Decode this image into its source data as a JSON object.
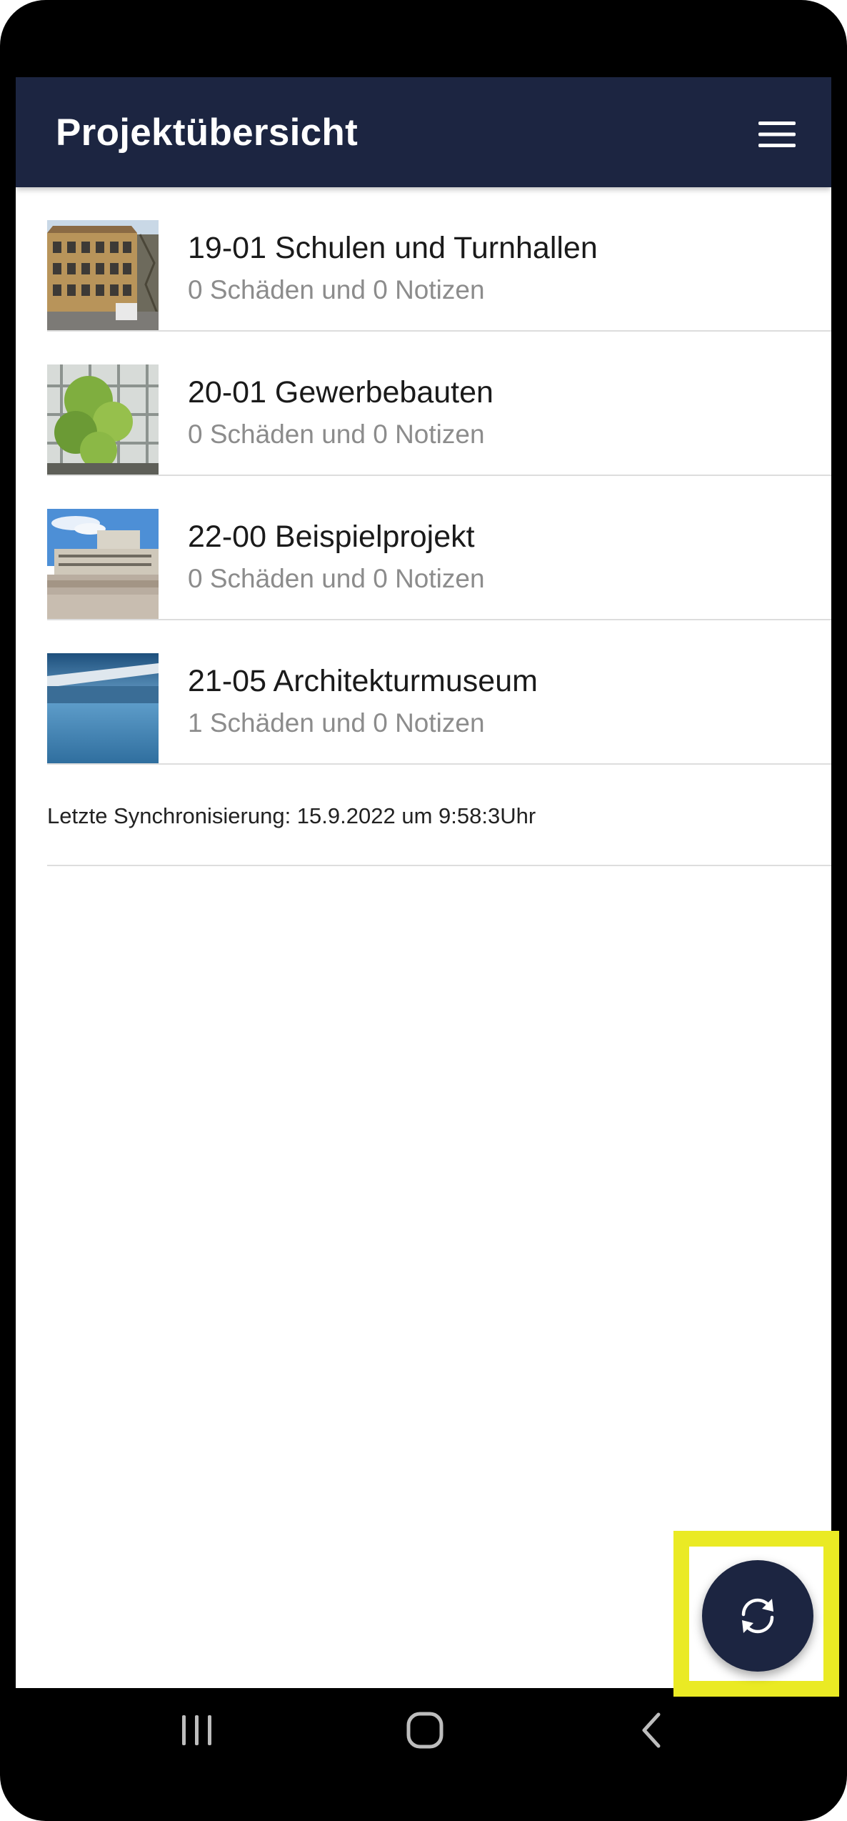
{
  "header": {
    "title": "Projektübersicht",
    "menu_icon": "hamburger-menu-icon"
  },
  "projects": [
    {
      "title": "19-01 Schulen und Turnhallen",
      "subtitle": "0 Schäden und 0 Notizen"
    },
    {
      "title": "20-01 Gewerbebauten",
      "subtitle": "0 Schäden und 0 Notizen"
    },
    {
      "title": "22-00 Beispielprojekt",
      "subtitle": "0 Schäden und 0 Notizen"
    },
    {
      "title": "21-05 Architekturmuseum",
      "subtitle": "1 Schäden und 0 Notizen"
    }
  ],
  "sync": {
    "last_sync": "Letzte Synchronisierung: 15.9.2022 um 9:58:3Uhr"
  },
  "fab": {
    "icon": "sync-icon"
  },
  "system_nav": {
    "recents_icon": "recents-icon",
    "home_icon": "home-icon",
    "back_icon": "back-icon"
  },
  "colors": {
    "primary": "#1c2541",
    "highlight": "#eaea24",
    "subtitle": "#8c8c8c",
    "divider": "#dddddd"
  }
}
